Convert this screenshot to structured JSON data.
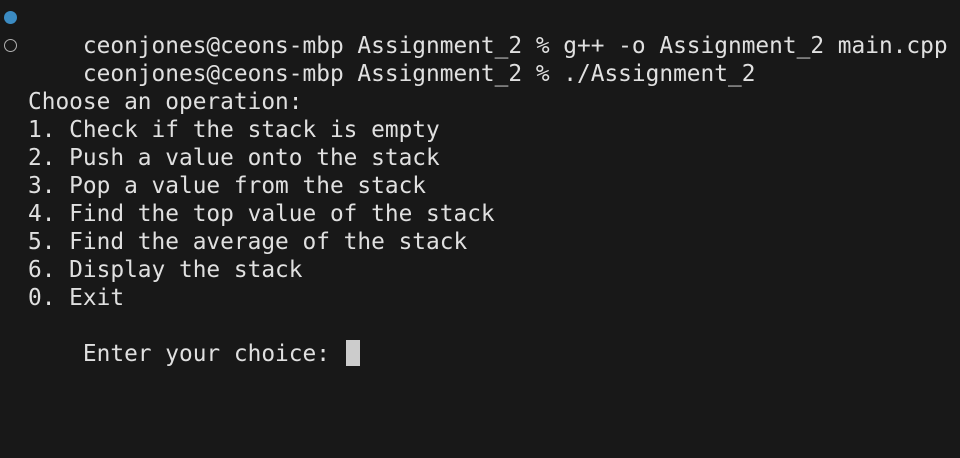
{
  "terminal": {
    "commands": [
      {
        "prompt": "ceonjones@ceons-mbp Assignment_2 % ",
        "command": "g++ -o Assignment_2 main.cpp",
        "status": "completed"
      },
      {
        "prompt": "ceonjones@ceons-mbp Assignment_2 % ",
        "command": "./Assignment_2",
        "status": "running"
      }
    ],
    "output": {
      "heading": "Choose an operation:",
      "options": [
        "1. Check if the stack is empty",
        "2. Push a value onto the stack",
        "3. Pop a value from the stack",
        "4. Find the top value of the stack",
        "5. Find the average of the stack",
        "6. Display the stack",
        "0. Exit"
      ],
      "input_prompt": "Enter your choice: ",
      "input_value": ""
    }
  },
  "colors": {
    "background": "#181818",
    "text": "#e0e0e0",
    "status_dot_completed": "#3b8bc2",
    "status_dot_running": "#b0b0b0",
    "cursor": "#cccccc"
  }
}
